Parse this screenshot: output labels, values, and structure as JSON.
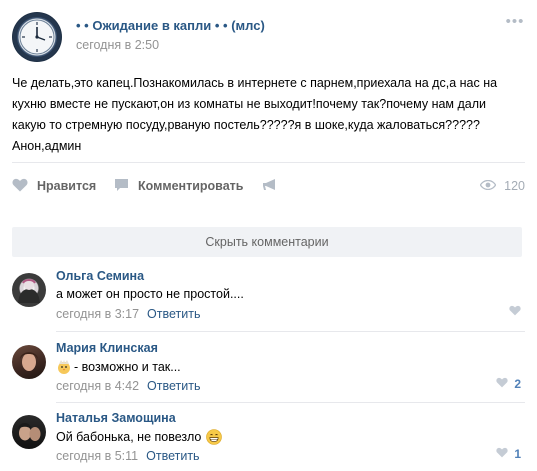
{
  "post": {
    "group_name": "• • Ожидание в капли • • (млс)",
    "time": "сегодня в 2:50",
    "menu_glyph": "•••",
    "text_lines": [
      "Че делать,это капец.Познакомилась в интернете с парнем,приехала на дс,а нас на",
      "кухню вместе не пускают,он из комнаты не выходит!почему так?почему нам дали",
      "какую то стремную посуду,рваную постель?????я в шоке,куда жаловаться?????",
      "Анон,админ"
    ]
  },
  "actions": {
    "like_label": "Нравится",
    "comment_label": "Комментировать",
    "views_count": "120"
  },
  "hide_comments_label": "Скрыть комментарии",
  "comments": [
    {
      "name": "Ольга Семина",
      "text": "а может он просто не простой....",
      "time": "сегодня в 3:17",
      "reply": "Ответить",
      "likes": ""
    },
    {
      "name": "Мария Клинская",
      "text": "- возможно и так...",
      "time": "сегодня в 4:42",
      "reply": "Ответить",
      "likes": "2"
    },
    {
      "name": "Наталья Замощина",
      "text": "Ой бабонька, не повезло",
      "time": "сегодня в 5:11",
      "reply": "Ответить",
      "likes": "1"
    }
  ],
  "icons": {
    "like": "heart-icon",
    "comment": "speech-bubble-icon",
    "share": "megaphone-icon",
    "views": "eye-icon"
  },
  "colors": {
    "link": "#2a5885",
    "meta": "#939393",
    "accent": "#5181b8",
    "icon_gray": "#b4bcc6"
  }
}
